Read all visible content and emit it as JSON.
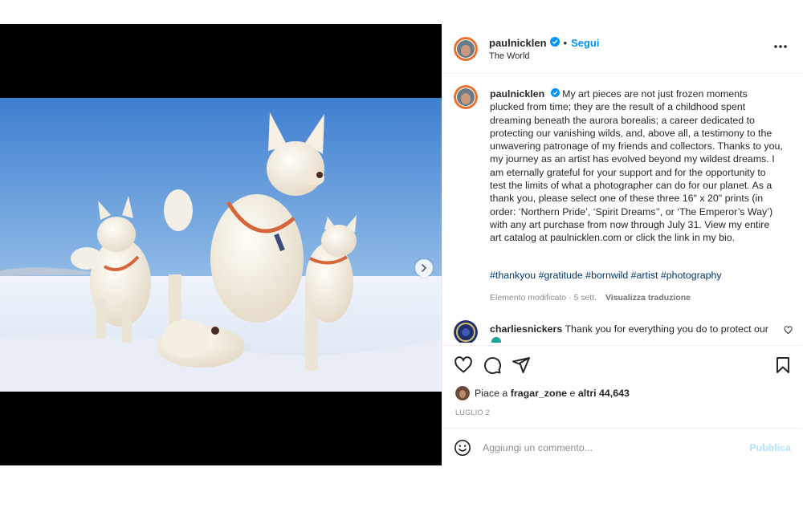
{
  "post": {
    "username": "paulnicklen",
    "follow_label": "Segui",
    "location": "The World",
    "caption_text": "My art pieces are not just frozen moments plucked from time; they are the result of a childhood spent dreaming beneath the aurora borealis; a career dedicated to protecting our vanishing wilds, and, above all, a testimony to the unwavering patronage of my friends and collectors. Thanks to you, my journey as an artist has evolved beyond my wildest dreams. I am eternally grateful for your support and for the opportunity to test the limits of what a photographer can do for our planet. As a thank you, please select one of these three 16\" x 20\" prints (in order: ‘Northern Pride’, ‘Spirit Dreams’’, or ‘The Emperor’s Way’) with any art purchase from now through July 31. View my entire art catalog at paulnicklen.com or click the link in my bio.",
    "hashtags": "#thankyou #gratitude #bornwild #artist #photography",
    "edited_label": "Elemento modificato · 5 sett.",
    "translate_label": "Visualizza traduzione"
  },
  "comment": {
    "username": "charliesnickers",
    "text": "Thank you for everything you do to protect our"
  },
  "likes": {
    "prefix": "Piace a",
    "user": "fragar_zone",
    "connector": "e",
    "others": "altri 44,643"
  },
  "date": "LUGLIO 2",
  "add_comment": {
    "placeholder": "Aggiungi un commento...",
    "publish_label": "Pubblica"
  },
  "colors": {
    "accent": "#0095f6",
    "publish_disabled": "#b2dffc",
    "hashtag": "#00376b",
    "muted": "#8e8e8e"
  },
  "icons": [
    "next-arrow-icon",
    "verified-badge-icon",
    "more-options-icon",
    "heart-icon",
    "comment-icon",
    "share-icon",
    "bookmark-icon",
    "emoji-icon"
  ]
}
